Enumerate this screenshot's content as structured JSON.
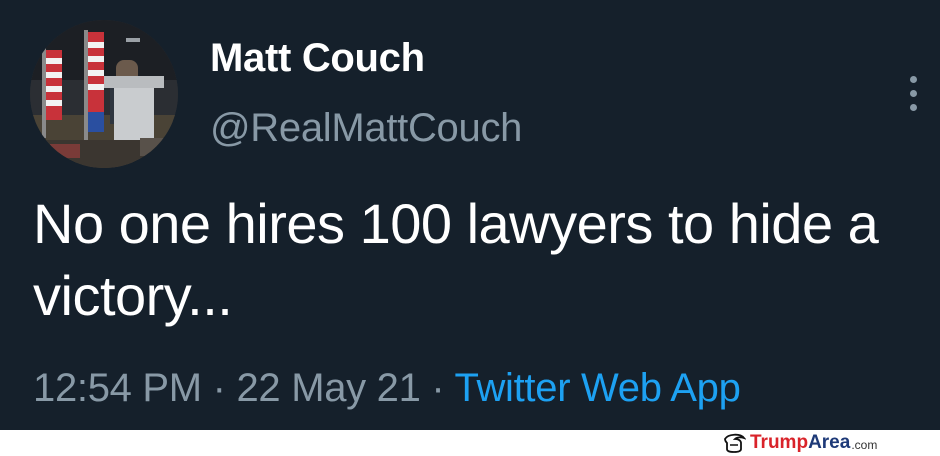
{
  "author": {
    "display_name": "Matt Couch",
    "handle": "@RealMattCouch",
    "avatar_icon": "profile-photo"
  },
  "tweet": {
    "text": "No one hires 100 lawyers to hide a victory...",
    "time": "12:54 PM",
    "separator": "·",
    "date": "22 May 21",
    "source": "Twitter Web App"
  },
  "more_icon": "more-vertical-icon",
  "watermark": {
    "part1": "Trump",
    "part2": "Area",
    "suffix": ".com"
  },
  "colors": {
    "background": "#15202b",
    "primary_text": "#ffffff",
    "secondary_text": "#8899a6",
    "accent": "#1da1f2"
  }
}
